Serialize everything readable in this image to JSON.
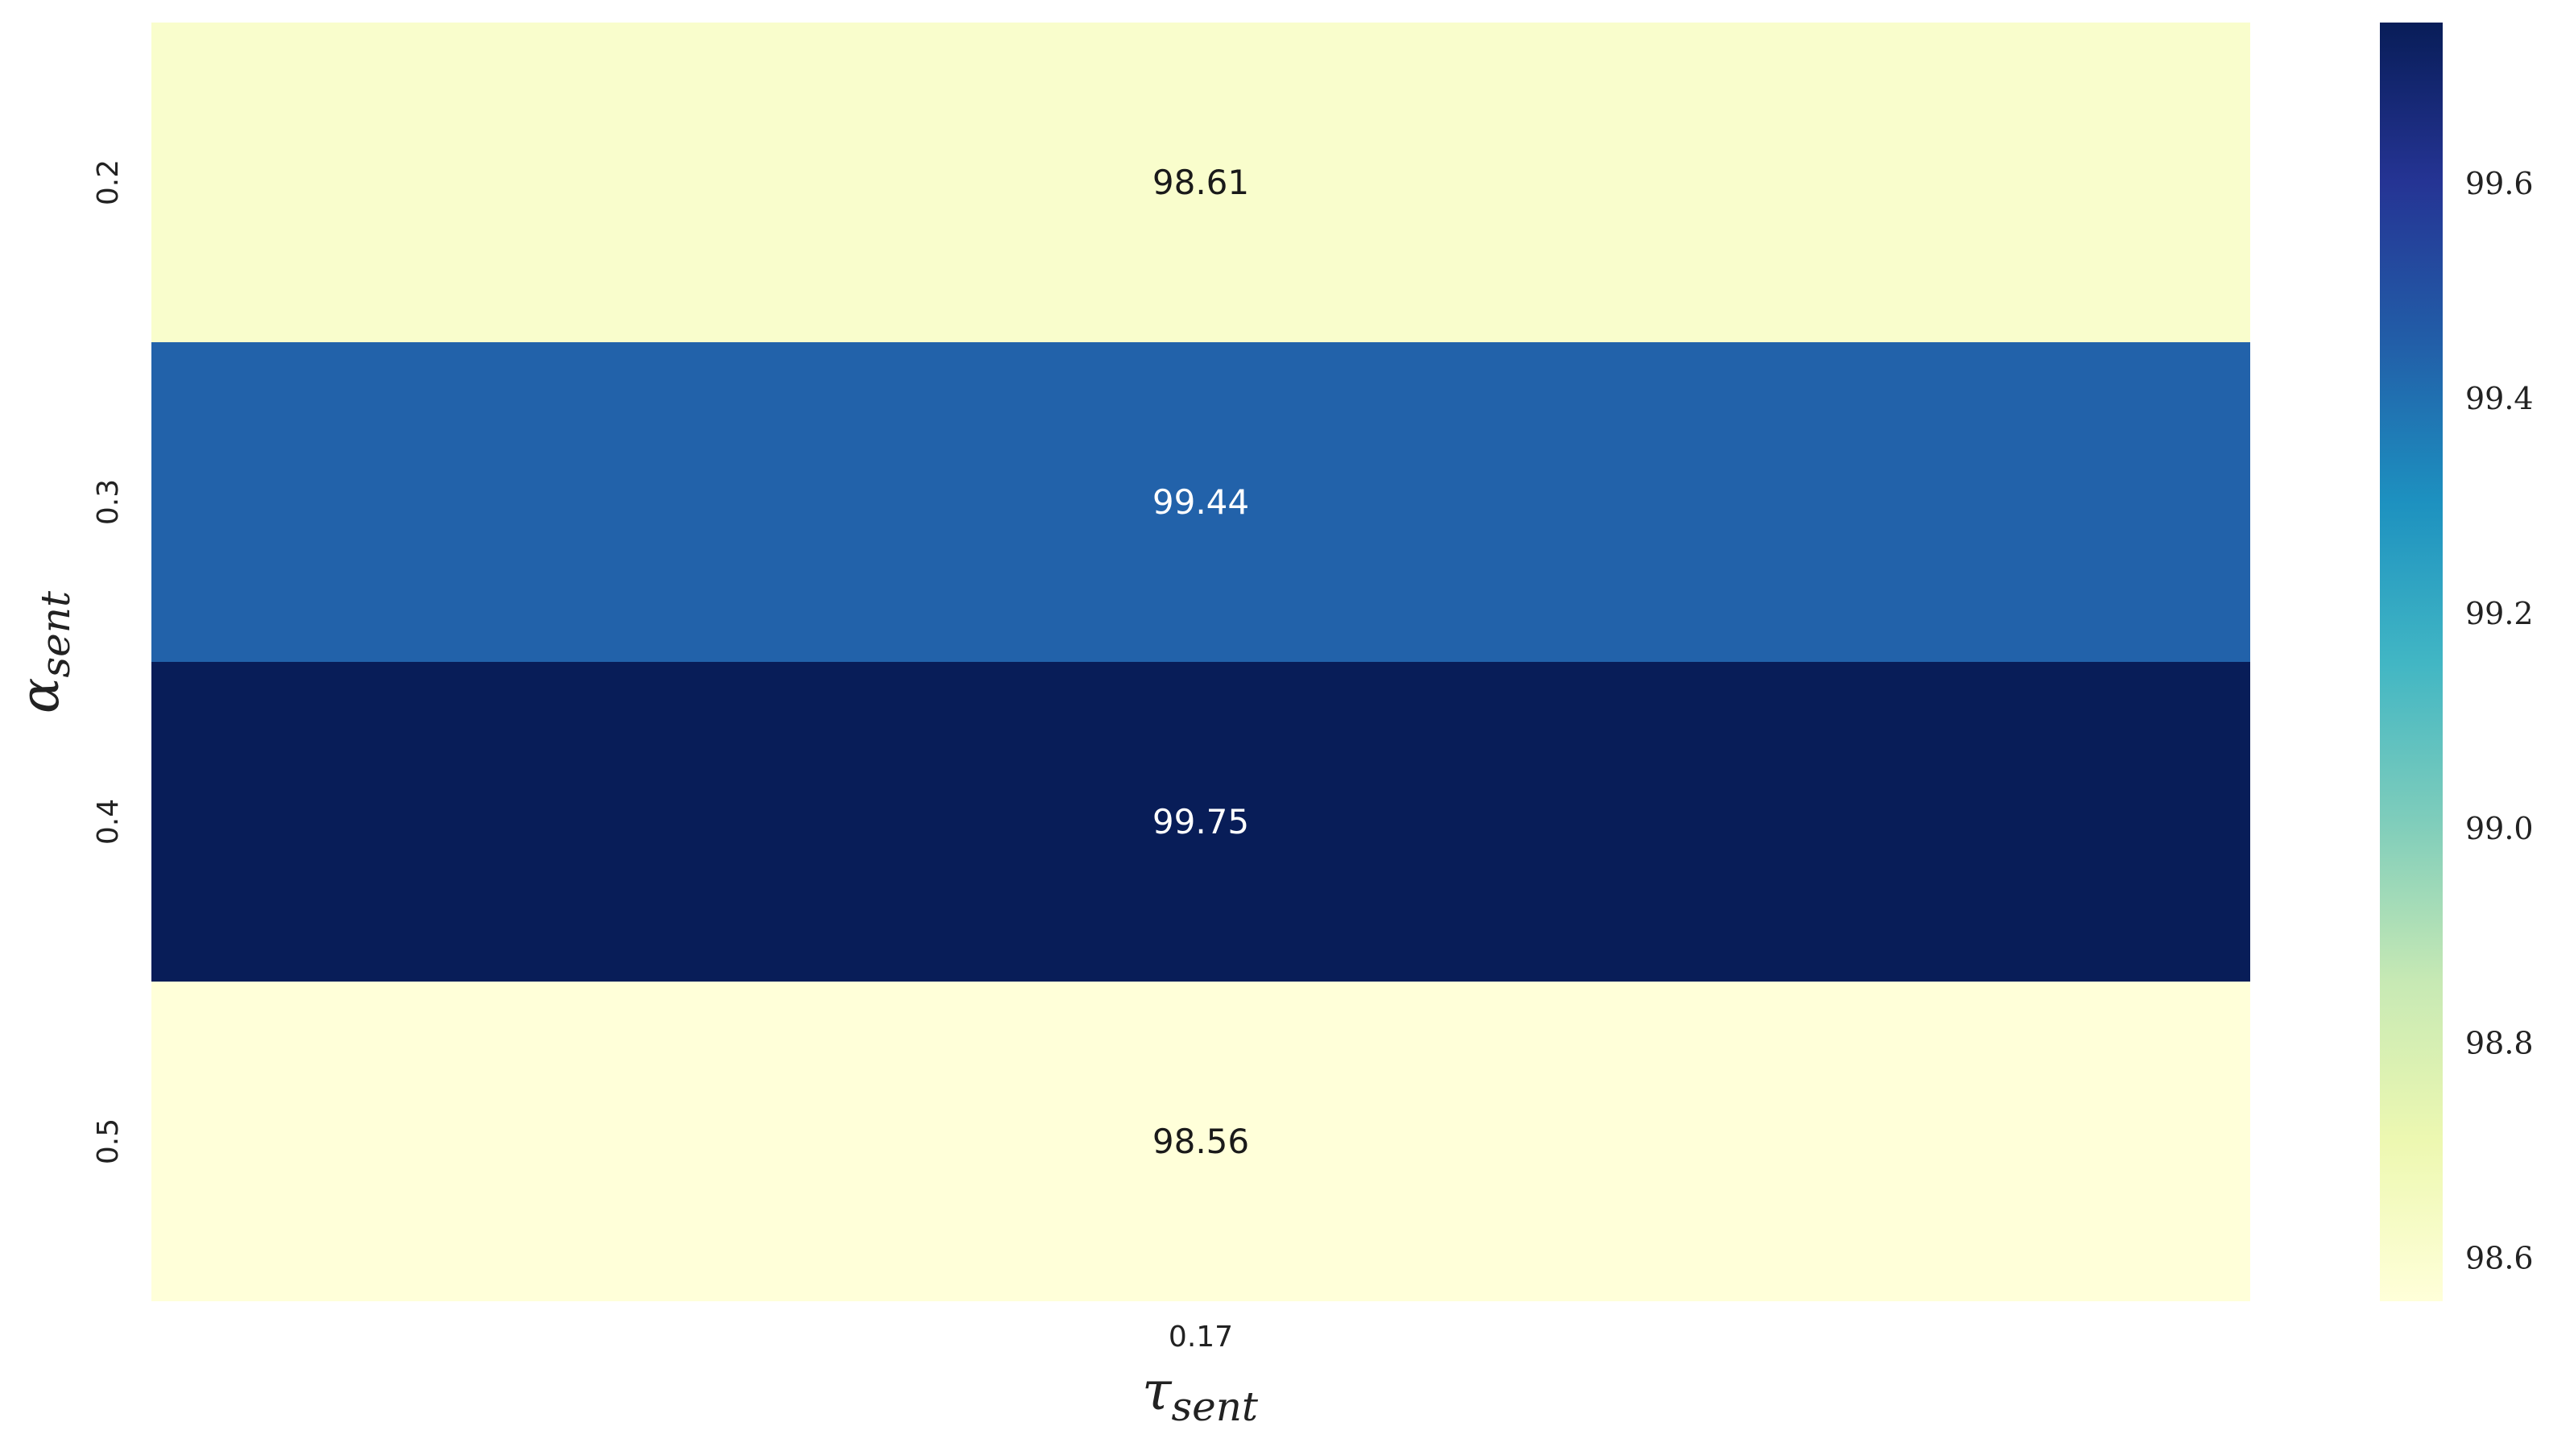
{
  "chart_data": {
    "type": "heatmap",
    "x_categories": [
      "0.17"
    ],
    "y_categories": [
      "0.2",
      "0.3",
      "0.4",
      "0.5"
    ],
    "values": [
      [
        98.61
      ],
      [
        99.44
      ],
      [
        99.75
      ],
      [
        98.56
      ]
    ],
    "value_labels": [
      [
        "98.61"
      ],
      [
        "99.44"
      ],
      [
        "99.75"
      ],
      [
        "98.56"
      ]
    ],
    "xlabel": "τ",
    "xlabel_sub": "sent",
    "ylabel": "α",
    "ylabel_sub": "sent",
    "colorbar": {
      "range": [
        98.56,
        99.75
      ],
      "ticks": [
        98.6,
        98.8,
        99.0,
        99.2,
        99.4,
        99.6
      ],
      "tick_labels": [
        "98.6",
        "98.8",
        "99.0",
        "99.2",
        "99.4",
        "99.6"
      ],
      "colormap": "YlGnBu",
      "colors": [
        "#ffffd9",
        "#edf8b1",
        "#c7e9b4",
        "#7fcdbb",
        "#41b6c4",
        "#1d91c0",
        "#225ea8",
        "#253494",
        "#081d58"
      ]
    },
    "grid": false
  }
}
